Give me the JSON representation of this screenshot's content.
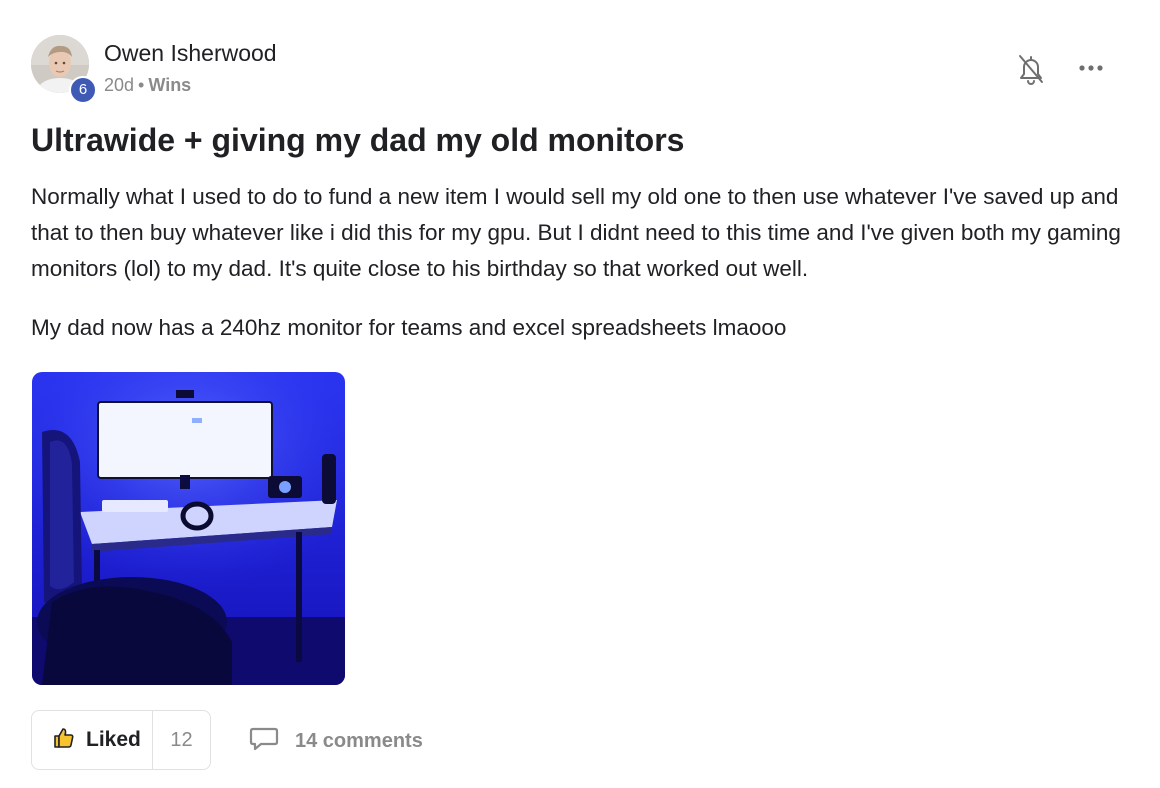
{
  "author": {
    "name": "Owen Isherwood",
    "level": "6",
    "avatar_icon": "avatar-photo"
  },
  "meta": {
    "age": "20d",
    "separator": "•",
    "category": "Wins"
  },
  "actions": {
    "bell_icon": "bell-off-icon",
    "more_icon": "more-horizontal-icon"
  },
  "post": {
    "title": "Ultrawide + giving my dad my old monitors",
    "paragraphs": [
      "Normally what I used to do to fund a new item I would sell my old one to then use whatever I've saved up and that to then buy whatever like i did this for my gpu. But I didnt need to this time and I've given both my gaming monitors (lol) to my dad. It's quite close to his birthday so that worked out well.",
      "My dad now has a 240hz monitor for teams and excel spreadsheets lmaooo"
    ],
    "image_icon": "desk-setup-photo"
  },
  "footer": {
    "like_label": "Liked",
    "like_count": "12",
    "comments_label": "14 comments"
  },
  "colors": {
    "badge": "#3f5ab5",
    "muted": "#8a8a8a",
    "photo_blue": "#1a1fd6"
  }
}
